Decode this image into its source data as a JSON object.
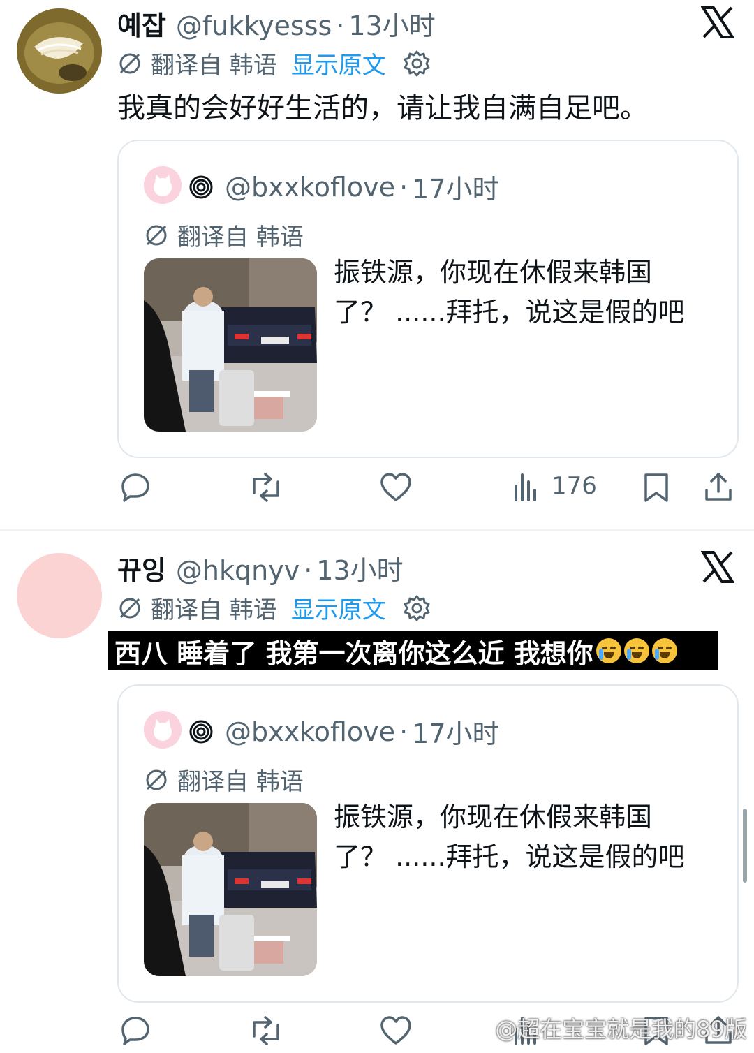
{
  "tweets": [
    {
      "name": "예잡",
      "handle": "@fukkyesss",
      "time": "13小时",
      "translated_from": "翻译自 韩语",
      "show_original": "显示原文",
      "text": "我真的会好好生活的，请让我自满自足吧。",
      "quote": {
        "handle": "@bxxkoflove",
        "time": "17小时",
        "translated_from": "翻译自 韩语",
        "text_line1": "振铁源，你现在休假来韩国",
        "text_line2": "了？ ......拜托，说这是假的吧"
      },
      "views": "176"
    },
    {
      "name": "뀨잉",
      "handle": "@hkqnyv",
      "time": "13小时",
      "translated_from": "翻译自 韩语",
      "show_original": "显示原文",
      "caption": "西八 睡着了 我第一次离你这么近 我想你",
      "quote": {
        "handle": "@bxxkoflove",
        "time": "17小时",
        "translated_from": "翻译自 韩语",
        "text_line1": "振铁源，你现在休假来韩国",
        "text_line2": "了？ ......拜托，说这是假的吧"
      }
    }
  ],
  "watermark": "@超在宝宝就是我的89版",
  "colors": {
    "link": "#1d9bf0",
    "muted": "#536471",
    "text": "#0f1419"
  },
  "icons": [
    "reply-icon",
    "retweet-icon",
    "like-icon",
    "views-icon",
    "bookmark-icon",
    "share-icon",
    "x-logo-icon",
    "gear-icon",
    "translate-icon",
    "spiral-icon"
  ]
}
